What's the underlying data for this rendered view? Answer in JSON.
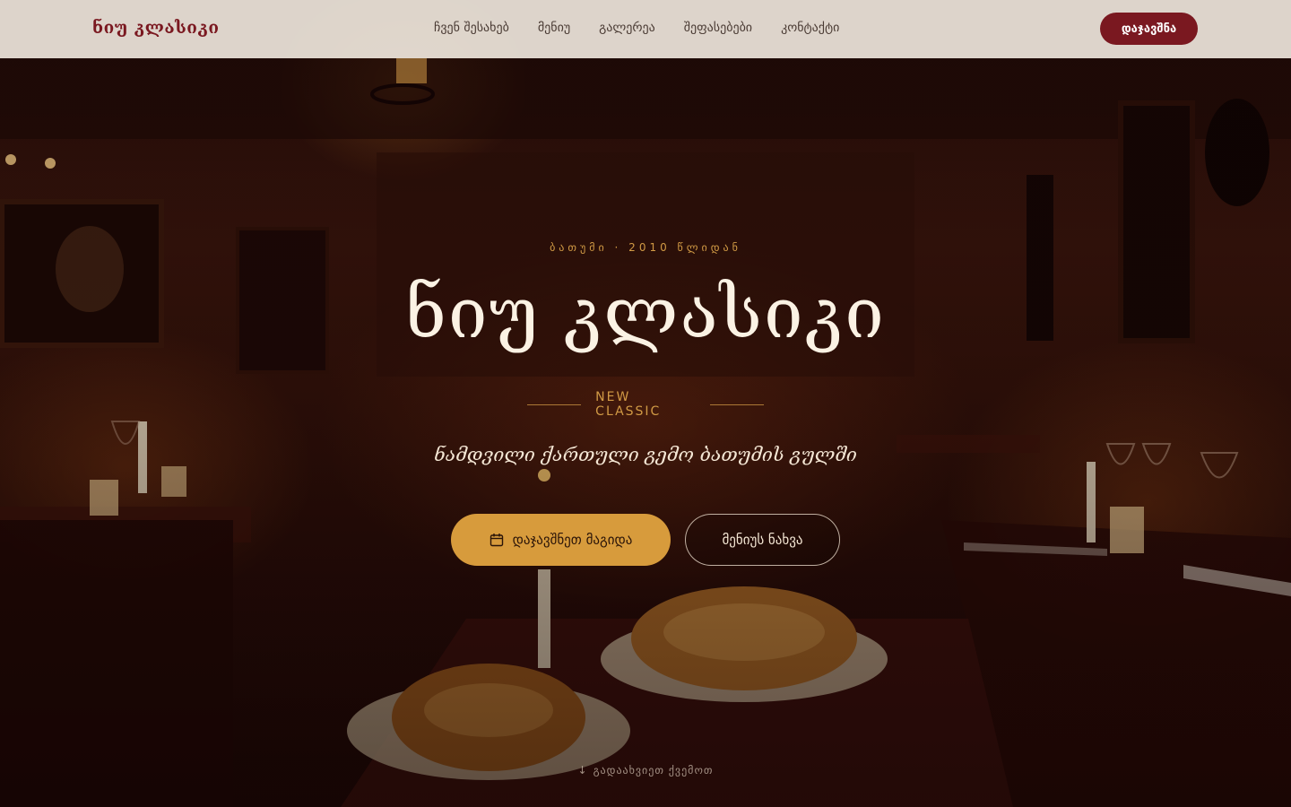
{
  "nav": {
    "brand": "ნიუ კლასიკი",
    "links": [
      "ჩვენ შესახებ",
      "მენიუ",
      "გალერეა",
      "შეფასებები",
      "კონტაქტი"
    ],
    "cta": "დაჯავშნა"
  },
  "hero": {
    "eyebrow": "ბათუმი · 2010 წლიდან",
    "title": "ნიუ კლასიკი",
    "subtitle": "NEW CLASSIC",
    "tagline": "ნამდვილი ქართული გემო ბათუმის გულში",
    "primary_button": {
      "icon": "calendar-icon",
      "label": "დაჯავშნეთ მაგიდა"
    },
    "secondary_button": {
      "label": "მენიუს ნახვა"
    },
    "scroll_arrow": "↓",
    "scroll_hint": "გადაახვიეთ ქვემოთ"
  },
  "colors": {
    "brand_red": "#7a1820",
    "gold": "#d79b3c",
    "nav_bg": "#ece4da",
    "cream": "#fbf2e4"
  }
}
